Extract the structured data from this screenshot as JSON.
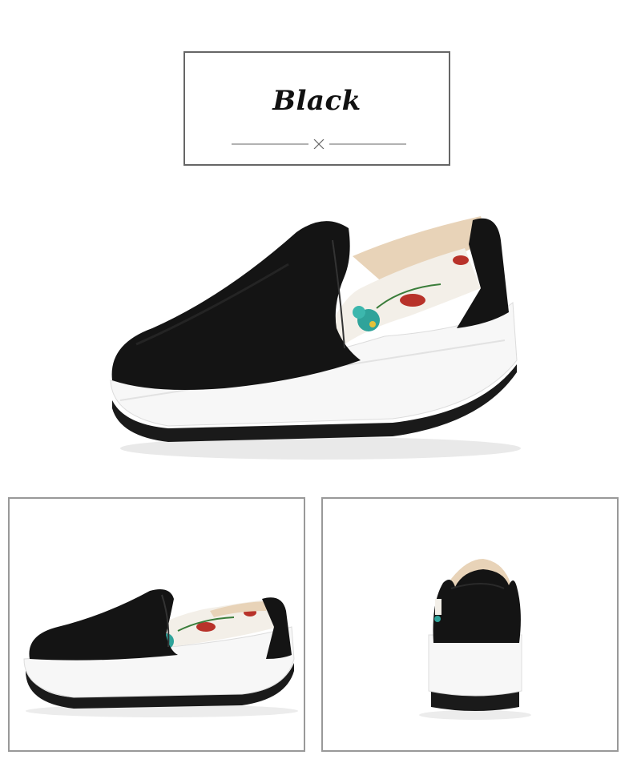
{
  "header": {
    "title": "Black"
  },
  "product": {
    "color_name": "Black",
    "images": [
      {
        "name": "main-view",
        "icon": "shoe-side-angle-image"
      },
      {
        "name": "side-view",
        "icon": "shoe-side-image"
      },
      {
        "name": "rear-view",
        "icon": "shoe-rear-image"
      }
    ]
  },
  "colors": {
    "leather": "#141414",
    "sole": "#f7f7f7",
    "outsole": "#1a1a1a",
    "lining": "#e8d3b8",
    "floral_teal": "#2fa39a",
    "floral_red": "#b8322a"
  }
}
